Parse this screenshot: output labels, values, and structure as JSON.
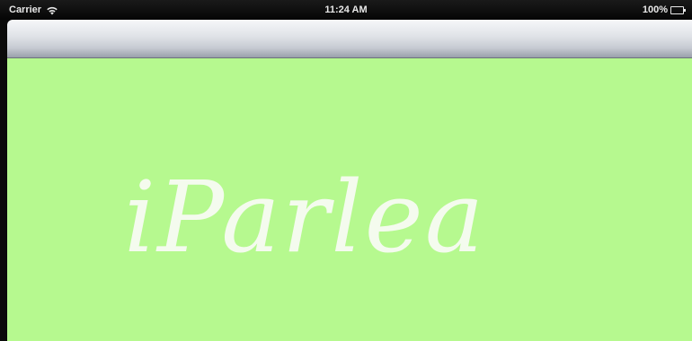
{
  "status_bar": {
    "carrier": "Carrier",
    "time": "11:24 AM",
    "battery": "100%",
    "wifi_icon": "wifi-icon",
    "battery_icon": "battery-icon"
  },
  "app": {
    "logo_text": "iParlea",
    "background_color": "#b6f98f",
    "logo_color": "#f4fbee"
  }
}
